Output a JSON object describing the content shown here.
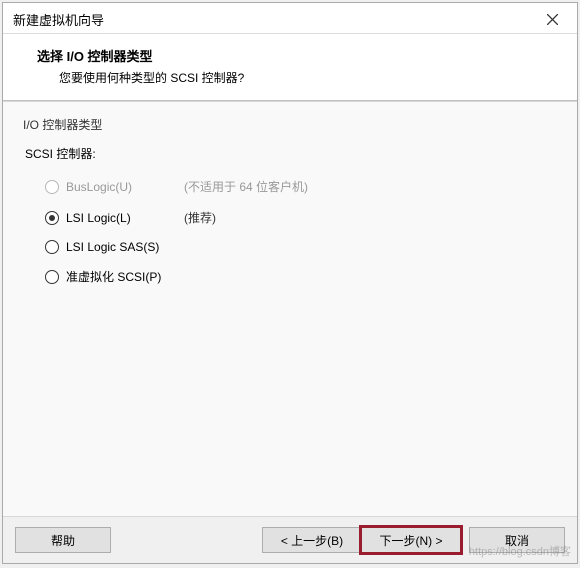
{
  "window": {
    "title": "新建虚拟机向导"
  },
  "header": {
    "title": "选择 I/O 控制器类型",
    "subtitle": "您要使用何种类型的 SCSI 控制器?"
  },
  "content": {
    "group_title": "I/O 控制器类型",
    "scsi_label": "SCSI 控制器:",
    "options": [
      {
        "label": "BusLogic(U)",
        "note": "(不适用于 64 位客户机)",
        "selected": false,
        "disabled": true
      },
      {
        "label": "LSI Logic(L)",
        "note": "(推荐)",
        "selected": true,
        "disabled": false
      },
      {
        "label": "LSI Logic SAS(S)",
        "note": "",
        "selected": false,
        "disabled": false
      },
      {
        "label": "准虚拟化 SCSI(P)",
        "note": "",
        "selected": false,
        "disabled": false
      }
    ]
  },
  "footer": {
    "help": "帮助",
    "back": "< 上一步(B)",
    "next": "下一步(N) >",
    "cancel": "取消"
  },
  "watermark": "https://blog.csdn博客"
}
